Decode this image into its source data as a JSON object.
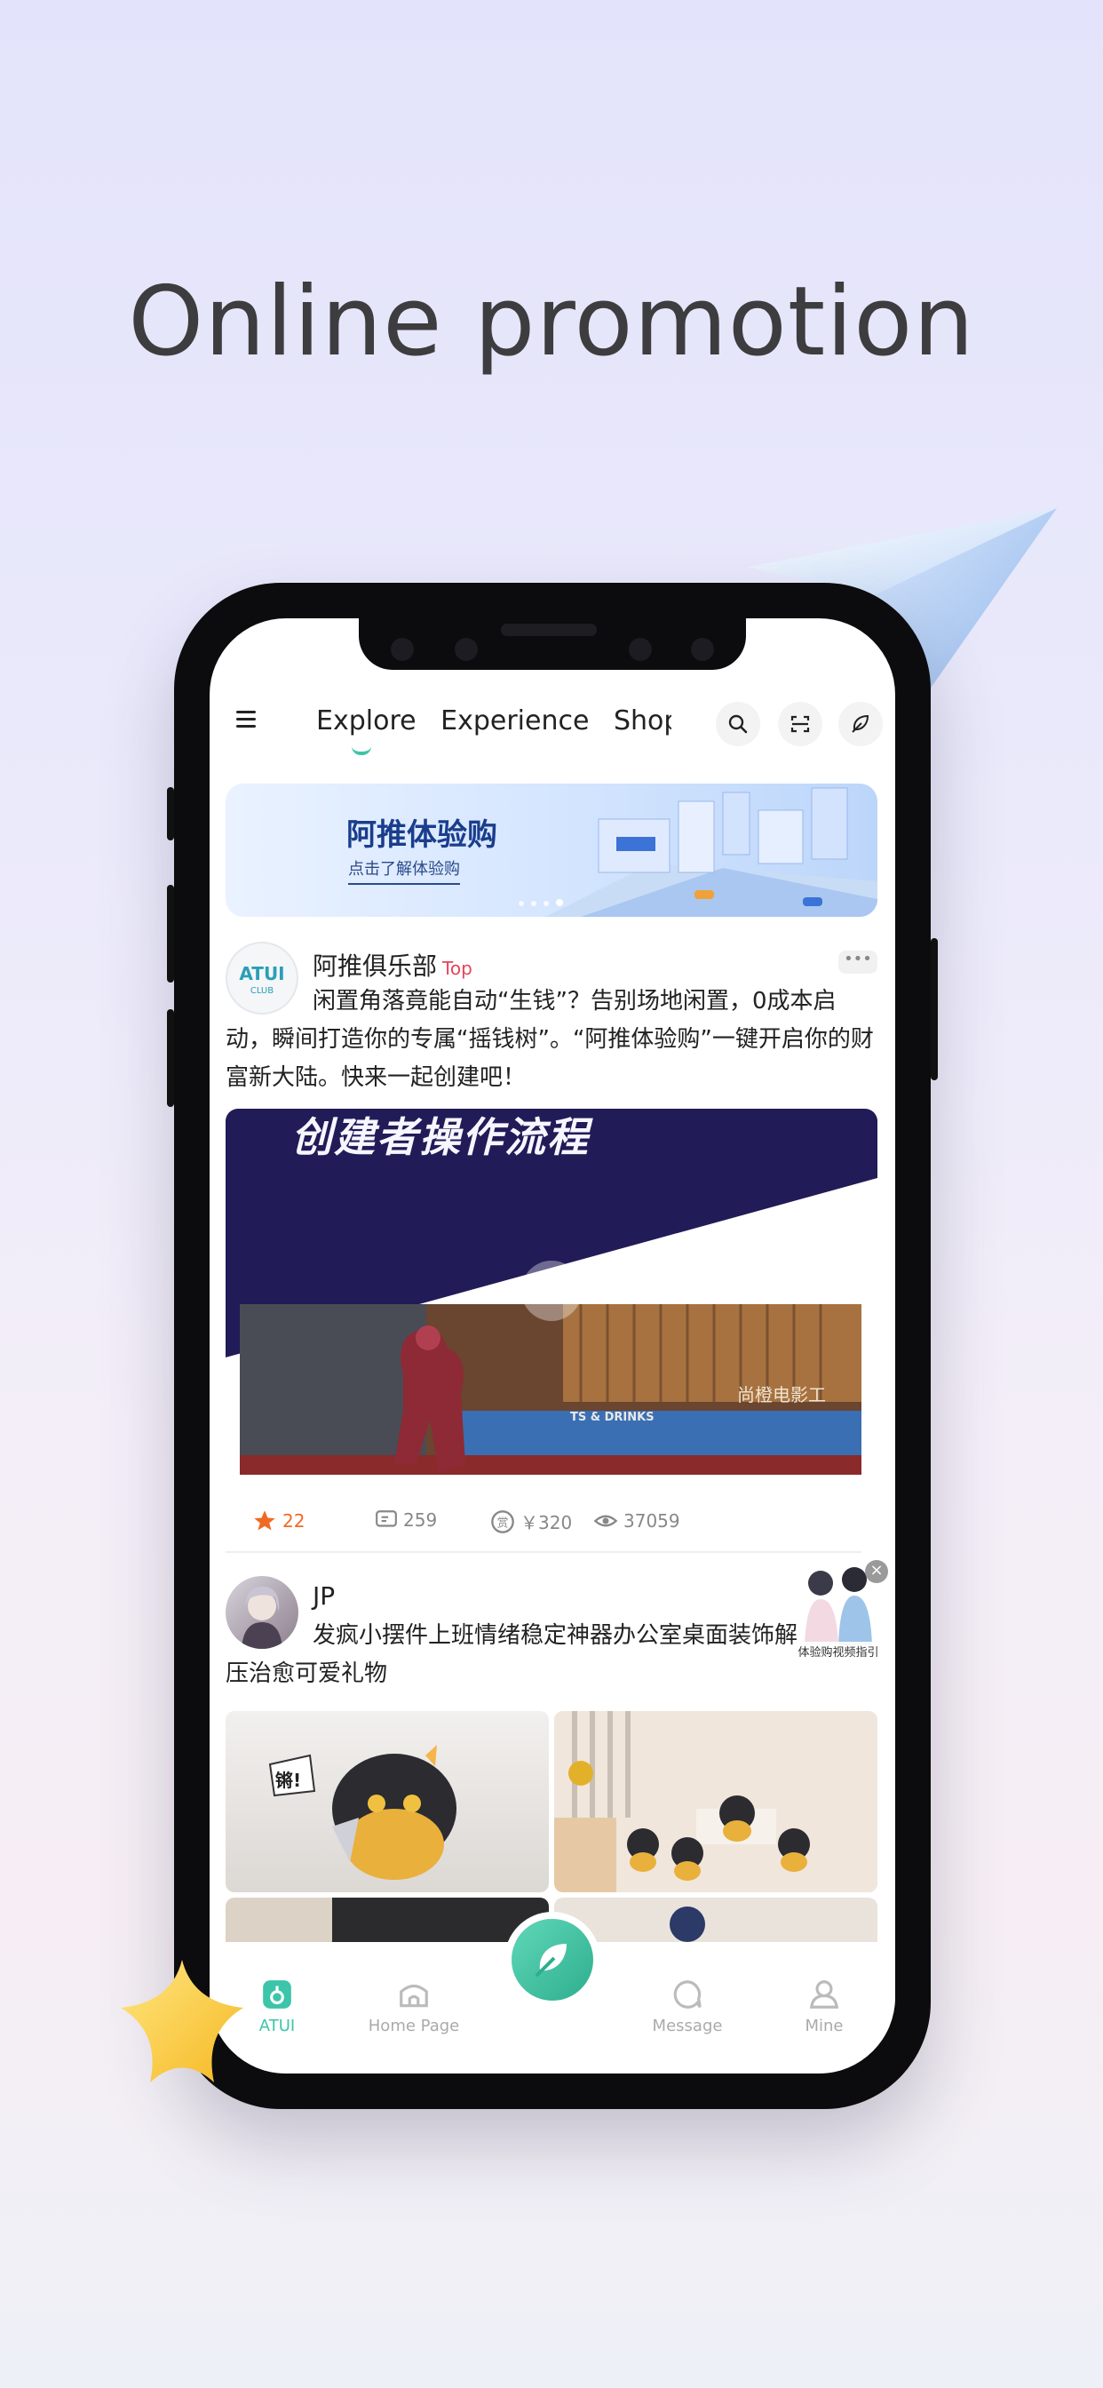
{
  "headline": "Online promotion",
  "nav": {
    "tabs": [
      "Explore",
      "Experience",
      "Shopp"
    ]
  },
  "banner": {
    "title": "阿推体验购",
    "subtitle": "点击了解体验购"
  },
  "posts": [
    {
      "author": "阿推俱乐部",
      "tag": "Top",
      "avatar_text": "ATUI",
      "avatar_sub": "CLUB",
      "more": "•••",
      "text": "闲置角落竟能自动“生钱”？告别场地闲置，0成本启动，瞬间打造你的专属“摇钱树”。“阿推体验购”一键开启你的财富新大陆。快来一起创建吧！",
      "video_caption": "创建者操作流程",
      "sign_text": "TS & DRINKS",
      "cinema_text": "尚橙电影工",
      "stats": {
        "likes": "22",
        "comments": "259",
        "reward": "￥320",
        "views": "37059"
      }
    },
    {
      "author": "JP",
      "text": "发疯小摆件上班情绪稳定神器办公室桌面装饰解压治愈可爱礼物",
      "sticker_text": "锵!"
    }
  ],
  "guide": {
    "label": "体验购视频指引",
    "close": "×"
  },
  "bottom_nav": {
    "items": [
      "ATUI",
      "Home Page",
      "Message",
      "Mine"
    ],
    "active": "ATUI"
  },
  "colors": {
    "accent": "#3cc5a8",
    "top_tag": "#e8435b",
    "like": "#f06a24"
  }
}
